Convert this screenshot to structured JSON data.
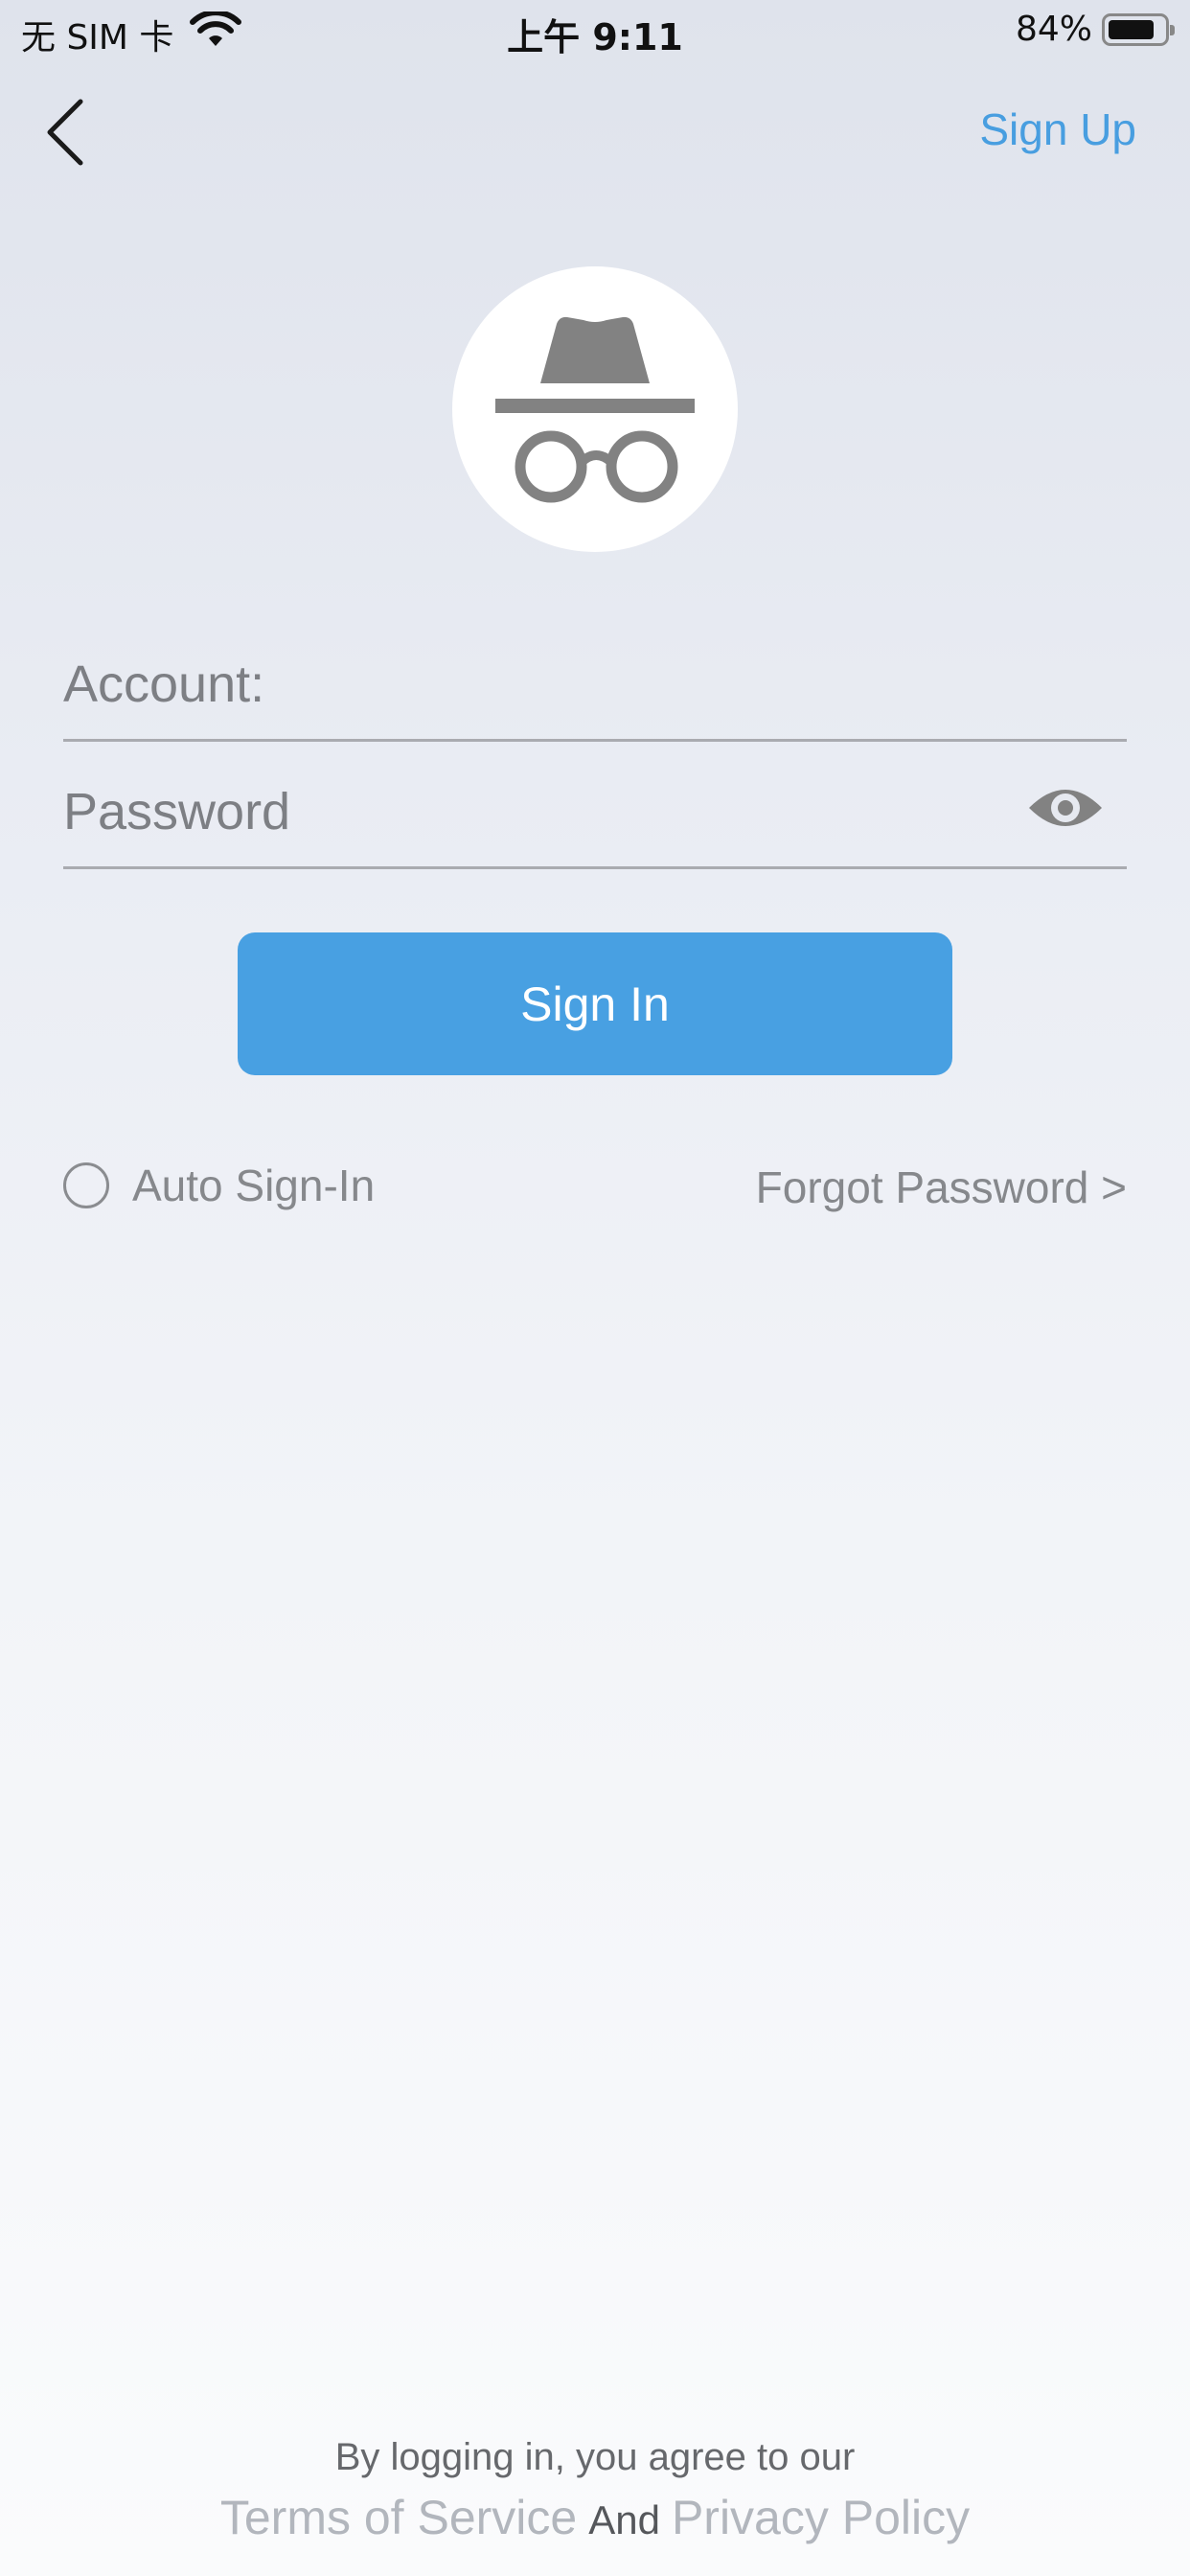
{
  "status_bar": {
    "carrier": "无 SIM 卡",
    "time": "上午 9:11",
    "battery_percent": "84%",
    "battery_level": 0.84,
    "wifi_icon": "wifi-icon"
  },
  "nav": {
    "back_icon": "chevron-left-icon",
    "sign_up_label": "Sign Up"
  },
  "avatar": {
    "icon": "incognito-icon"
  },
  "form": {
    "account_placeholder": "Account:",
    "account_value": "",
    "password_placeholder": "Password",
    "password_value": "",
    "eye_icon": "eye-icon",
    "sign_in_label": "Sign In",
    "auto_sign_in_label": "Auto Sign-In",
    "auto_sign_in_checked": false,
    "forgot_password_label": "Forgot Password >"
  },
  "footer": {
    "agree_text": "By logging in, you agree to our",
    "terms_label": "Terms of Service",
    "and_label": "And",
    "privacy_label": "Privacy Policy"
  },
  "colors": {
    "accent": "#48a0e2",
    "icon_gray": "#828282",
    "muted_text": "#86888c",
    "legal_link": "#b2b6bd"
  }
}
